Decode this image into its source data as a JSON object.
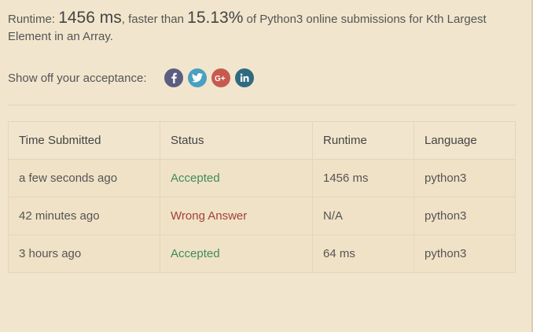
{
  "summary": {
    "runtime_label": "Runtime: ",
    "runtime_value": "1456 ms",
    "faster_than_label": ", faster than ",
    "percent_value": "15.13%",
    "rest_text": " of Python3 online submissions for Kth Largest Element in an Array."
  },
  "share": {
    "label": "Show off your acceptance:",
    "buttons": [
      {
        "name": "facebook",
        "icon": "facebook-icon",
        "color": "#5b5e80"
      },
      {
        "name": "twitter",
        "icon": "twitter-icon",
        "color": "#4aa0c0"
      },
      {
        "name": "google-plus",
        "icon": "google-plus-icon",
        "color": "#c75a4e"
      },
      {
        "name": "linkedin",
        "icon": "linkedin-icon",
        "color": "#2f6b80"
      }
    ]
  },
  "table": {
    "headers": [
      "Time Submitted",
      "Status",
      "Runtime",
      "Language"
    ],
    "rows": [
      {
        "time": "a few seconds ago",
        "status": "Accepted",
        "runtime": "1456 ms",
        "language": "python3"
      },
      {
        "time": "42 minutes ago",
        "status": "Wrong Answer",
        "runtime": "N/A",
        "language": "python3"
      },
      {
        "time": "3 hours ago",
        "status": "Accepted",
        "runtime": "64 ms",
        "language": "python3"
      }
    ]
  },
  "colors": {
    "background": "#f1e6cd",
    "accepted": "#3f8a5f",
    "wrong_answer": "#a43f3f"
  }
}
